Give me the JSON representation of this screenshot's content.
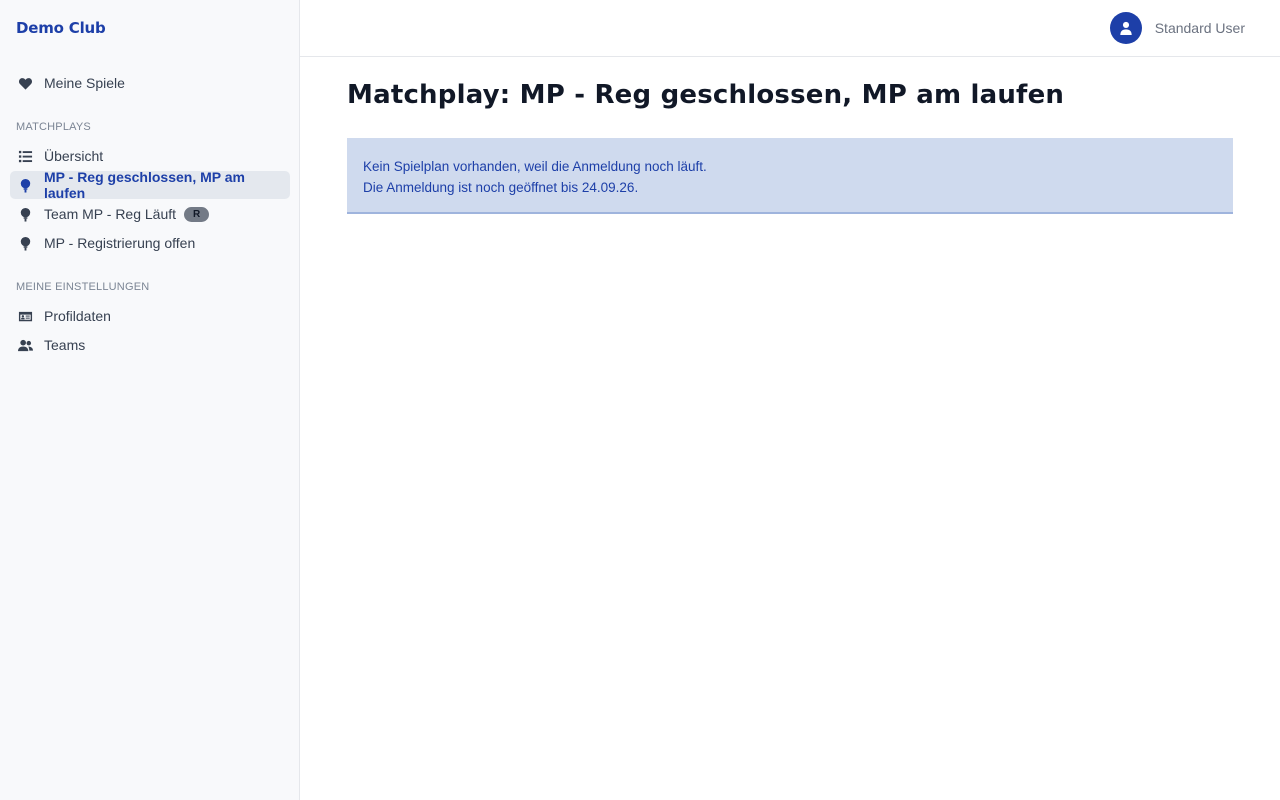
{
  "brand": "Demo Club",
  "user": {
    "name": "Standard User",
    "icon": "user-icon"
  },
  "sidebar": {
    "my_games": {
      "label": "Meine Spiele",
      "icon": "heart-icon"
    },
    "matchplays": {
      "heading": "MATCHPLAYS",
      "items": [
        {
          "label": "Übersicht",
          "icon": "list-icon"
        },
        {
          "label": "MP - Reg geschlossen, MP am laufen",
          "icon": "golf-ball-icon",
          "active": true
        },
        {
          "label": "Team MP - Reg Läuft",
          "icon": "golf-ball-icon",
          "badge": "R"
        },
        {
          "label": "MP - Registrierung offen",
          "icon": "golf-ball-icon"
        }
      ]
    },
    "settings": {
      "heading": "MEINE EINSTELLUNGEN",
      "items": [
        {
          "label": "Profildaten",
          "icon": "id-card-icon"
        },
        {
          "label": "Teams",
          "icon": "users-icon"
        }
      ]
    }
  },
  "main": {
    "title": "Matchplay: MP - Reg geschlossen, MP am laufen",
    "alert": {
      "line1": "Kein Spielplan vorhanden, weil die Anmeldung noch läuft.",
      "line2": "Die Anmeldung ist noch geöffnet bis 24.09.26."
    }
  },
  "colors": {
    "accent": "#1d3fa8",
    "sidebar_bg": "#f8f9fb",
    "active_bg": "#e4e8ee",
    "alert_bg": "#cfdaee"
  }
}
